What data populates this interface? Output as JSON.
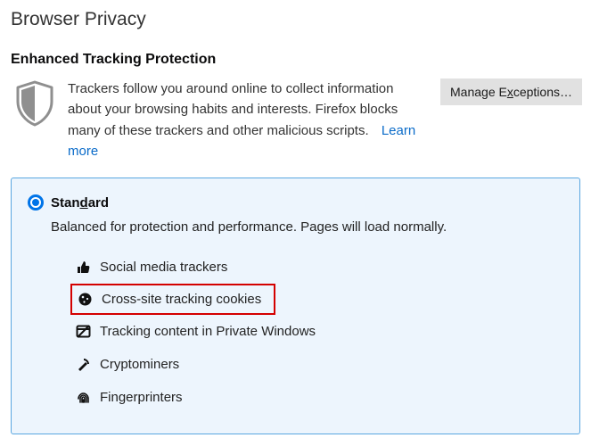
{
  "page": {
    "title": "Browser Privacy"
  },
  "section": {
    "heading": "Enhanced Tracking Protection"
  },
  "intro": {
    "text": "Trackers follow you around online to collect information about your browsing habits and interests. Firefox blocks many of these trackers and other malicious scripts.",
    "learn_more": "Learn more"
  },
  "buttons": {
    "manage_exceptions_pre": "Manage E",
    "manage_exceptions_u": "x",
    "manage_exceptions_post": "ceptions…"
  },
  "option": {
    "title_pre": "Stan",
    "title_u": "d",
    "title_post": "ard",
    "description": "Balanced for protection and performance. Pages will load normally."
  },
  "protections": {
    "social": "Social media trackers",
    "cross_site": "Cross-site tracking cookies",
    "private_windows": "Tracking content in Private Windows",
    "cryptominers": "Cryptominers",
    "fingerprinters": "Fingerprinters"
  }
}
